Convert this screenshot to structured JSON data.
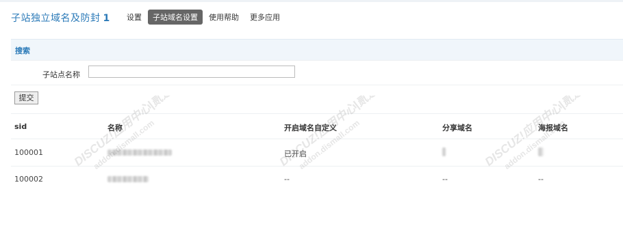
{
  "header": {
    "title": "子站独立域名及防封",
    "title_number": "1",
    "nav": [
      "设置",
      "子站域名设置",
      "使用帮助",
      "更多应用"
    ],
    "active_nav": "子站域名设置"
  },
  "search": {
    "heading": "搜索",
    "field_label": "子站点名称",
    "field_value": "",
    "submit_label": "提交"
  },
  "table": {
    "columns": [
      "sid",
      "名称",
      "开启域名自定义",
      "分享域名",
      "海报域名"
    ],
    "rows": [
      {
        "sid": "100001",
        "name": "[blurred]",
        "custom": "已开启",
        "share": "[blurred]",
        "poster": "[blurred]"
      },
      {
        "sid": "100002",
        "name": "[blurred]",
        "custom": "--",
        "share": "--",
        "poster": "--"
      }
    ]
  },
  "watermark": {
    "line1": "DISCUZ!应用中心|贰道",
    "line2": "addon.dismall.com",
    "mark": "®"
  },
  "colors": {
    "accent": "#2b7ab8",
    "section_bg": "#f0f6fb",
    "active_tab_bg": "#666666"
  }
}
